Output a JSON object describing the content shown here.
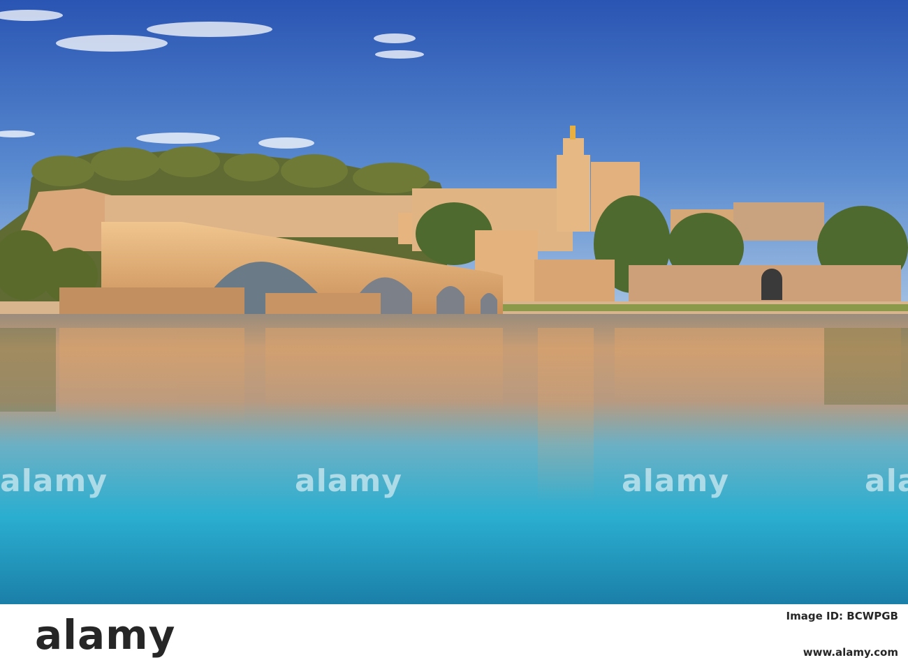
{
  "watermark": {
    "text": "alamy"
  },
  "footer": {
    "logo_text": "alamy",
    "image_id": "Image ID: BCWPGB",
    "url": "www.alamy.com"
  },
  "colors": {
    "sky_top": "#2b59b8",
    "sky_horizon": "#8fb4de",
    "stone_lit": "#e8b27a",
    "water_top": "#c8a07e",
    "water_bottom": "#1fa8c9"
  }
}
